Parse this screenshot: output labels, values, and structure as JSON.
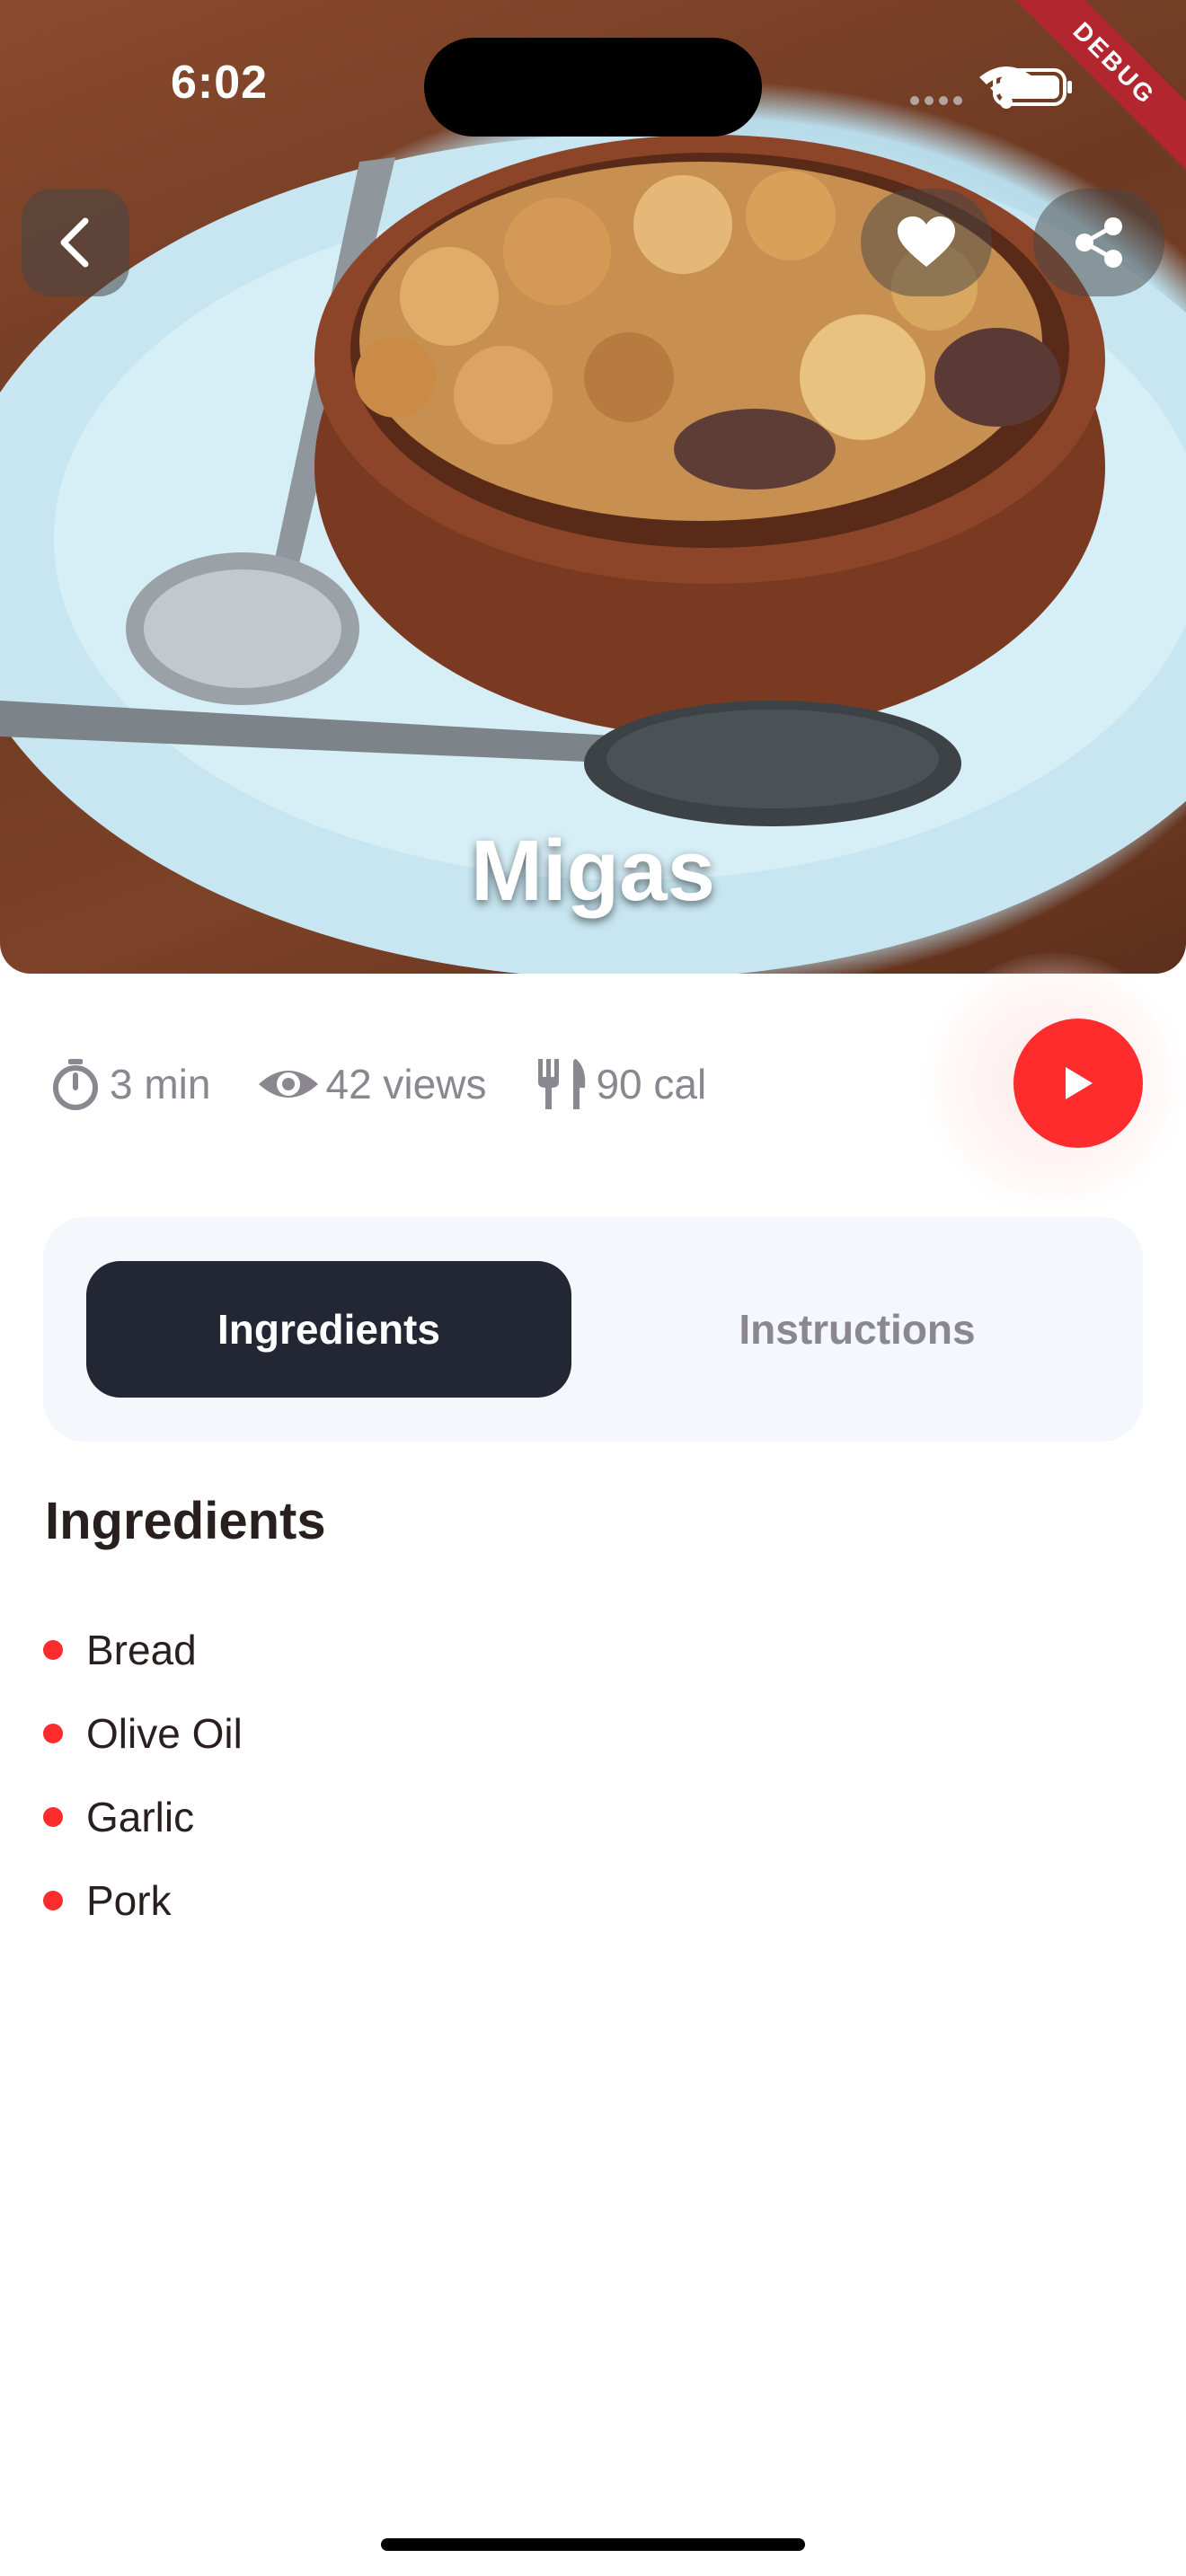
{
  "status_bar": {
    "time": "6:02",
    "debug_label": "DEBUG"
  },
  "hero": {
    "title": "Migas"
  },
  "stats": [
    {
      "icon": "timer-icon",
      "text": "3 min"
    },
    {
      "icon": "eye-icon",
      "text": "42 views"
    },
    {
      "icon": "utensils-icon",
      "text": "90 cal"
    }
  ],
  "tabs": {
    "ingredients": "Ingredients",
    "instructions": "Instructions"
  },
  "ingredients": {
    "title": "Ingredients",
    "items": [
      "Bread",
      "Olive Oil",
      "Garlic",
      "Pork"
    ]
  },
  "colors": {
    "accent": "#fe2c2c",
    "dark": "#232733",
    "muted": "#8a8791",
    "tab_bg": "#f4f7fb"
  }
}
